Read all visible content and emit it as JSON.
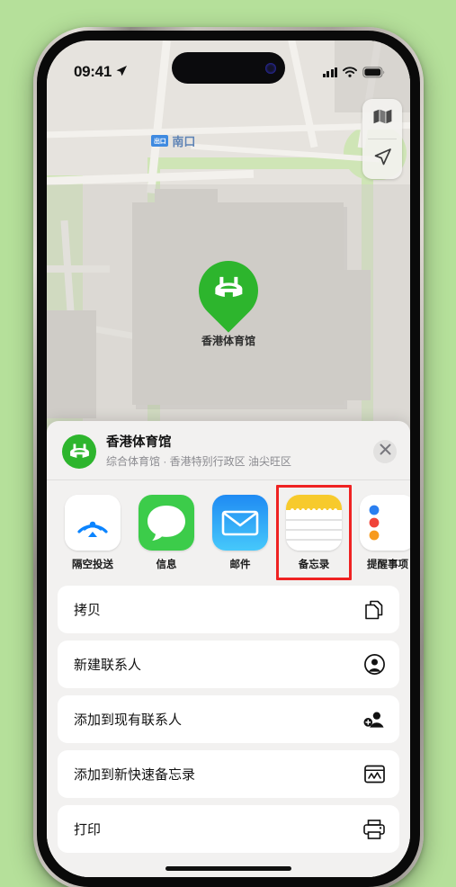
{
  "status_bar": {
    "time": "09:41",
    "location_arrow_icon": "location-arrow-icon",
    "cellular_icon": "cellular-signal-icon",
    "wifi_icon": "wifi-icon",
    "battery_icon": "battery-full-icon"
  },
  "map": {
    "controls": [
      {
        "icon": "map-layers-icon",
        "name": "map-type-button"
      },
      {
        "icon": "location-arrow-icon",
        "name": "recenter-location-button"
      }
    ],
    "transit_label": {
      "badge": "出口",
      "name": "南口"
    },
    "poi": {
      "label": "香港体育馆",
      "icon": "stadium-icon",
      "pin_color": "#2db52d"
    }
  },
  "share_sheet": {
    "title": "香港体育馆",
    "subtitle": "综合体育馆 · 香港特别行政区 油尖旺区",
    "header_icon": "stadium-icon",
    "close_icon": "close-x-icon",
    "apps": [
      {
        "label": "隔空投送",
        "icon": "airdrop-icon",
        "highlighted": false
      },
      {
        "label": "信息",
        "icon": "messages-icon",
        "highlighted": false
      },
      {
        "label": "邮件",
        "icon": "mail-icon",
        "highlighted": false
      },
      {
        "label": "备忘录",
        "icon": "notes-icon",
        "highlighted": true
      },
      {
        "label": "提醒事项",
        "icon": "reminders-icon",
        "highlighted": false
      }
    ],
    "actions": [
      {
        "label": "拷贝",
        "icon": "copy-icon"
      },
      {
        "label": "新建联系人",
        "icon": "new-contact-icon"
      },
      {
        "label": "添加到现有联系人",
        "icon": "add-to-contact-icon"
      },
      {
        "label": "添加到新快速备忘录",
        "icon": "quick-note-icon"
      },
      {
        "label": "打印",
        "icon": "printer-icon"
      }
    ]
  },
  "colors": {
    "background": "#b5e09a",
    "accent_green": "#2db52d",
    "highlight_red": "#ef2222",
    "sheet_bg": "#f2f1f0"
  }
}
